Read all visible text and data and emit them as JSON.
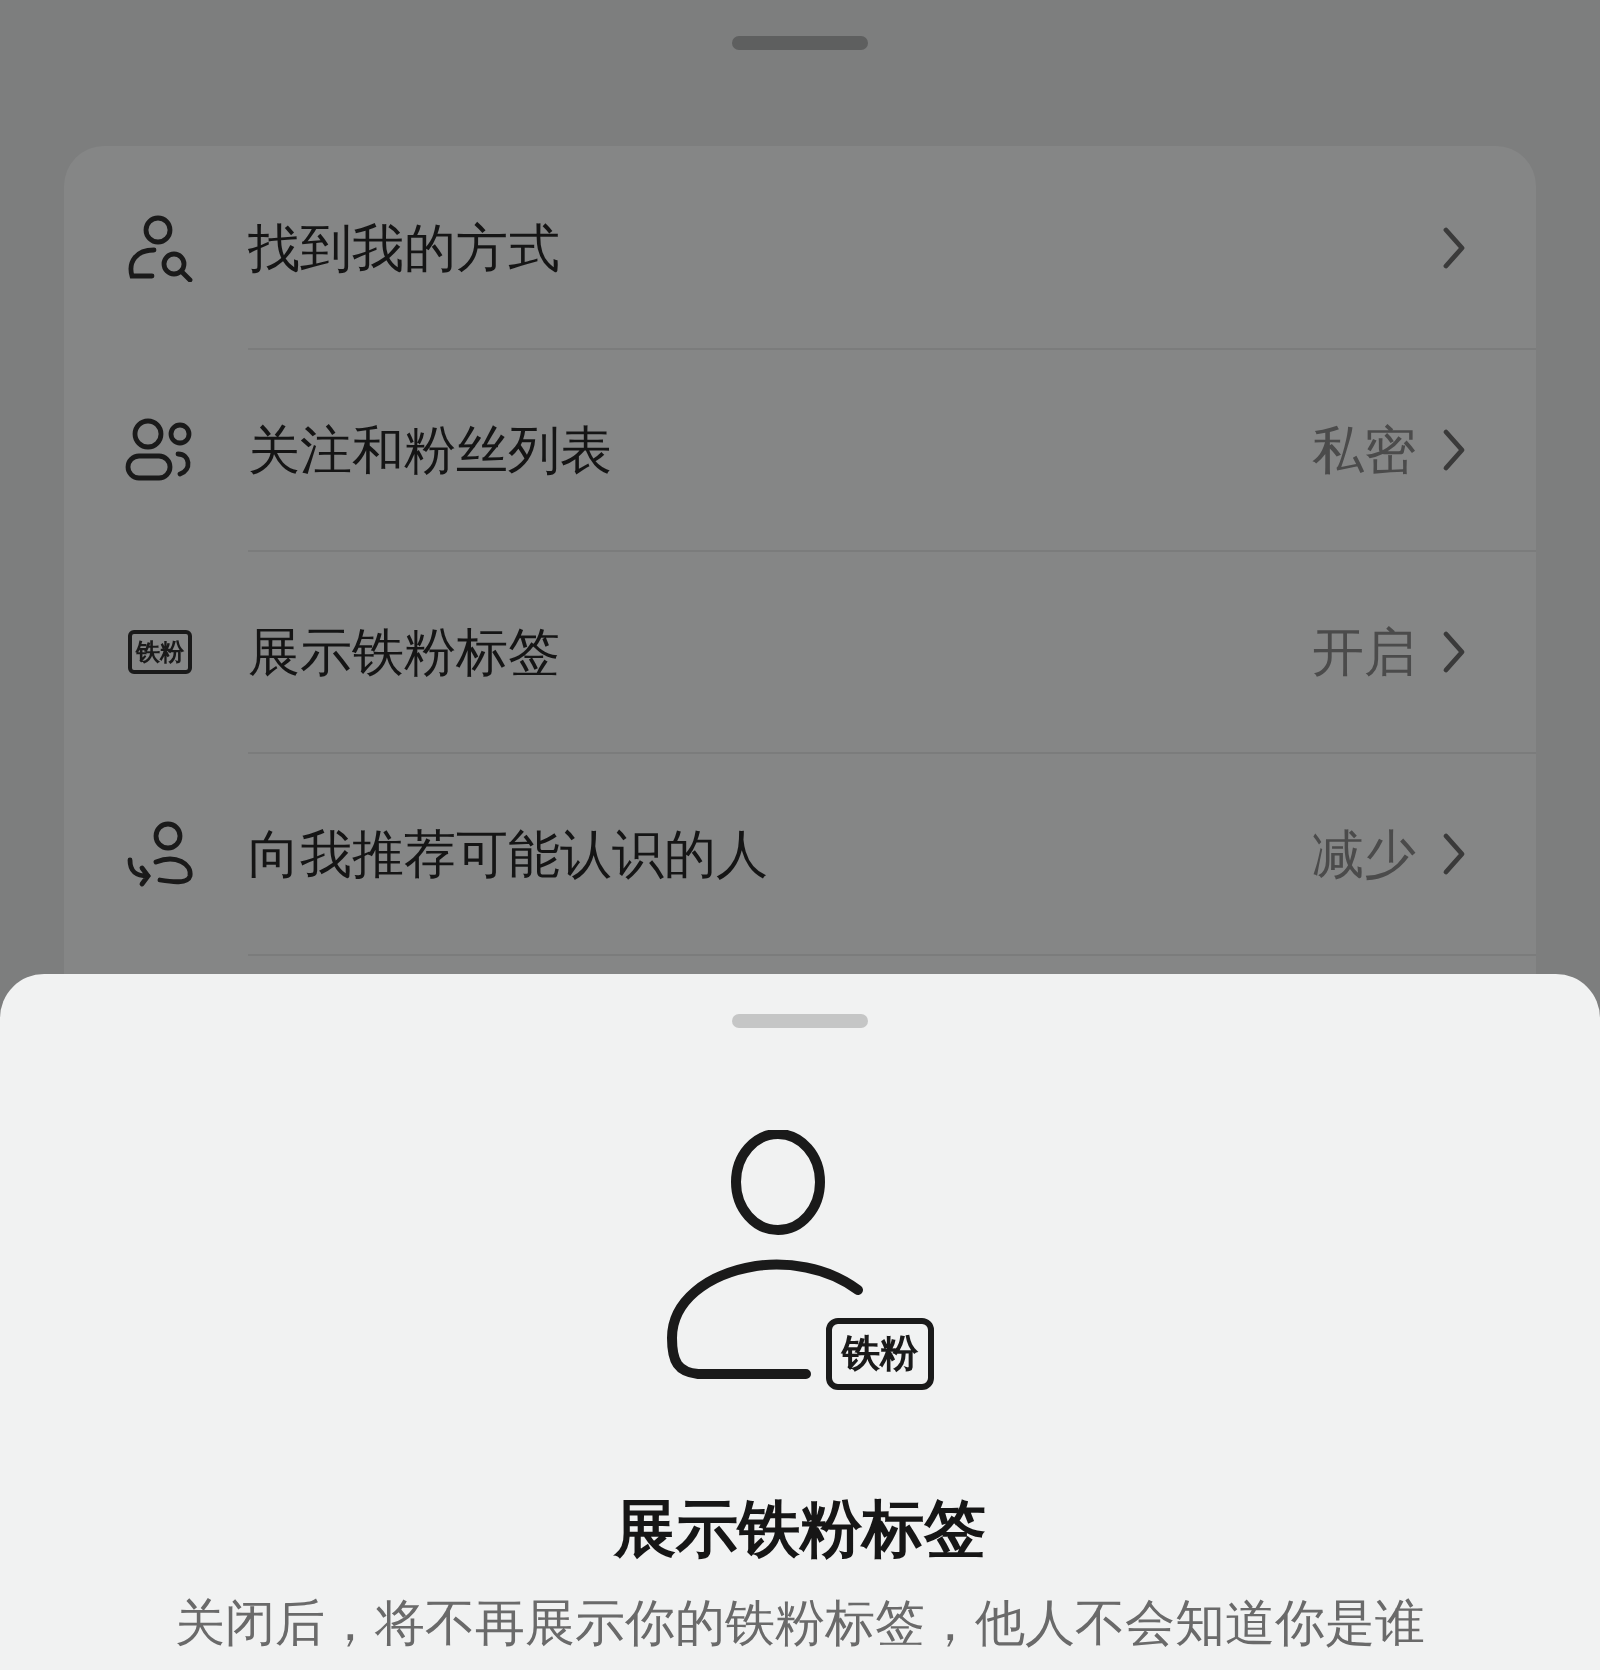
{
  "settings": [
    {
      "kind": "find",
      "label": "找到我的方式"
    },
    {
      "kind": "followers",
      "label": "关注和粉丝列表",
      "value": "私密"
    },
    {
      "kind": "badge",
      "label": "展示铁粉标签",
      "value": "开启",
      "badge": "铁粉"
    },
    {
      "kind": "recommend",
      "label": "向我推荐可能认识的人",
      "value": "减少"
    }
  ],
  "sheet": {
    "badge": "铁粉",
    "title": "展示铁粉标签",
    "description": "关闭后，将不再展示你的铁粉标签，他人不会知道你是谁"
  }
}
